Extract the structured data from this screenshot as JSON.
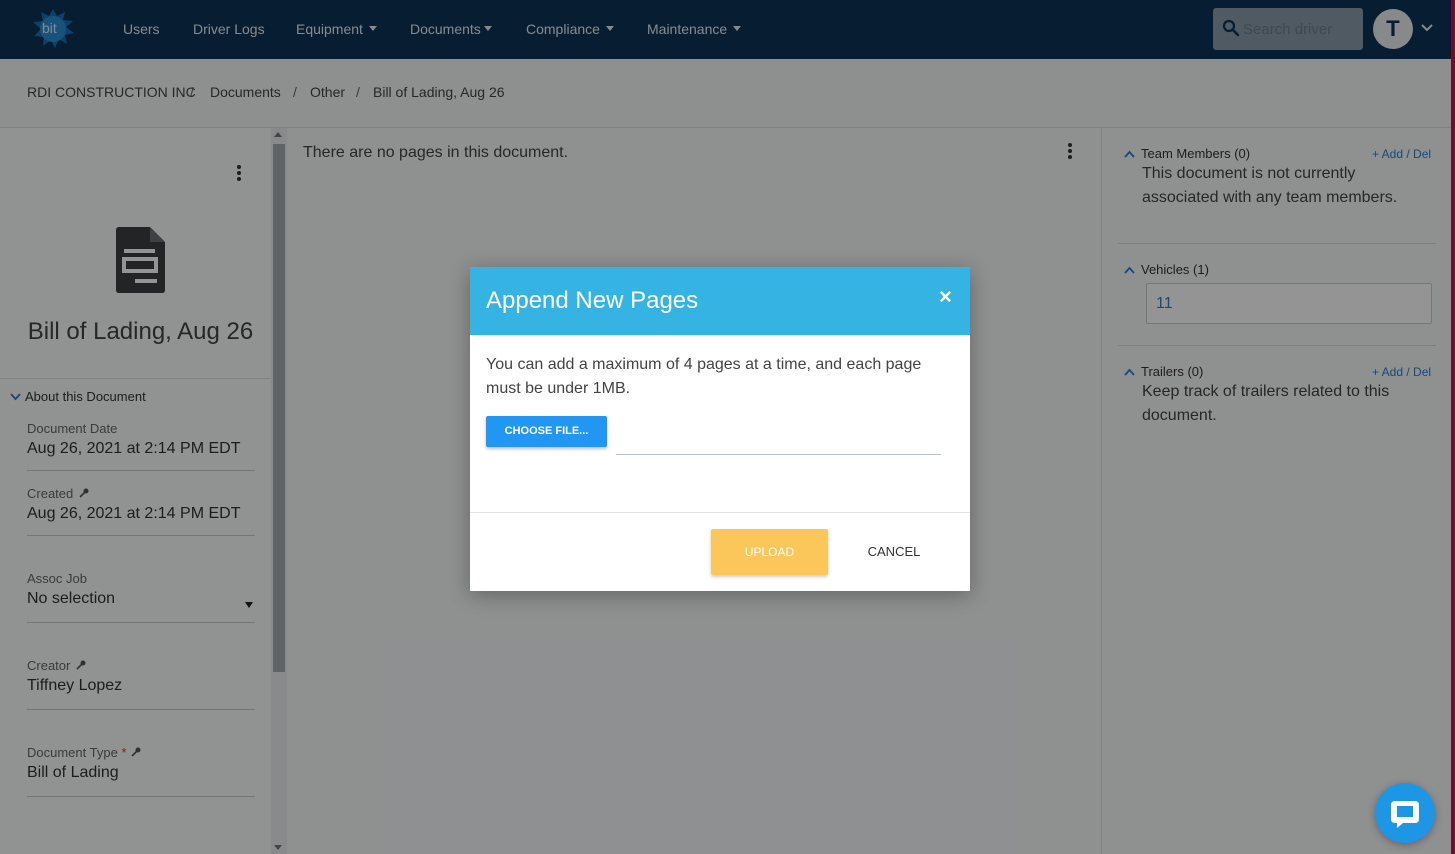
{
  "nav": {
    "logo_text": "bit",
    "items": [
      {
        "label": "Users",
        "dropdown": false
      },
      {
        "label": "Driver Logs",
        "dropdown": false
      },
      {
        "label": "Equipment",
        "dropdown": true
      },
      {
        "label": "Documents",
        "dropdown": true
      },
      {
        "label": "Compliance",
        "dropdown": true
      },
      {
        "label": "Maintenance",
        "dropdown": true
      }
    ],
    "search_placeholder": "Search driver",
    "avatar_letter": "T"
  },
  "breadcrumb": [
    "RDI CONSTRUCTION INC",
    "Documents",
    "Other",
    "Bill of Lading, Aug 26"
  ],
  "breadcrumb_separator": "/",
  "document": {
    "title": "Bill of Lading, Aug 26",
    "section_label": "About this Document",
    "fields": {
      "document_date": {
        "label": "Document Date",
        "value": "Aug 26, 2021 at 2:14 PM EDT"
      },
      "created": {
        "label": "Created",
        "value": "Aug 26, 2021 at 2:14 PM EDT"
      },
      "assoc_job": {
        "label": "Assoc Job",
        "value": "No selection"
      },
      "creator": {
        "label": "Creator",
        "value": "Tiffney Lopez"
      },
      "document_type": {
        "label": "Document Type",
        "required_mark": "*",
        "value": "Bill of Lading"
      }
    }
  },
  "center": {
    "empty_message": "There are no pages in this document."
  },
  "sidebar_right": {
    "team_members": {
      "heading": "Team Members (0)",
      "link": "+ Add / Del",
      "text": "This document is not currently associated with any team members."
    },
    "vehicles": {
      "heading": "Vehicles (1)",
      "value": "11"
    },
    "trailers": {
      "heading": "Trailers (0)",
      "link": "+ Add / Del",
      "text": "Keep track of trailers related to this document."
    }
  },
  "modal": {
    "title": "Append New Pages",
    "close": "×",
    "text": "You can add a maximum of 4 pages at a time, and each page must be under 1MB.",
    "choose_file": "CHOOSE FILE...",
    "upload": "UPLOAD",
    "cancel": "CANCEL"
  },
  "colors": {
    "nav_bg": "#0b3357",
    "modal_header": "#35b4e3",
    "primary_button": "#2196f3",
    "upload_button": "#fcc75a",
    "link": "#2a7fd4",
    "chat_button": "#1e96e6"
  },
  "icons": [
    "search-icon",
    "chevron-down-icon",
    "kebab-menu-icon",
    "document-icon",
    "key-icon",
    "chevron-up-icon",
    "close-icon",
    "chat-icon"
  ]
}
